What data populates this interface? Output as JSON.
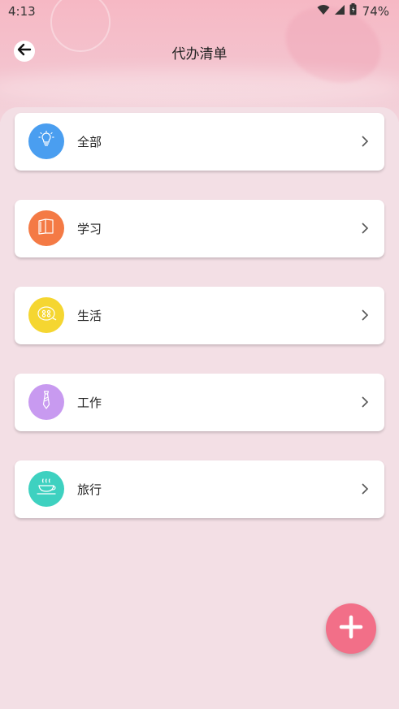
{
  "status_bar": {
    "time": "4:13",
    "battery": "74%"
  },
  "header": {
    "title": "代办清单"
  },
  "categories": [
    {
      "label": "全部",
      "icon": "lightbulb-icon",
      "color": "#4a9ef0"
    },
    {
      "label": "学习",
      "icon": "book-icon",
      "color": "#f47a45"
    },
    {
      "label": "生活",
      "icon": "donut-icon",
      "color": "#f5d631"
    },
    {
      "label": "工作",
      "icon": "tie-icon",
      "color": "#c89af0"
    },
    {
      "label": "旅行",
      "icon": "coffee-cup-icon",
      "color": "#3ed1c0"
    }
  ],
  "fab": {
    "icon": "plus-icon",
    "color": "#f26f88"
  }
}
